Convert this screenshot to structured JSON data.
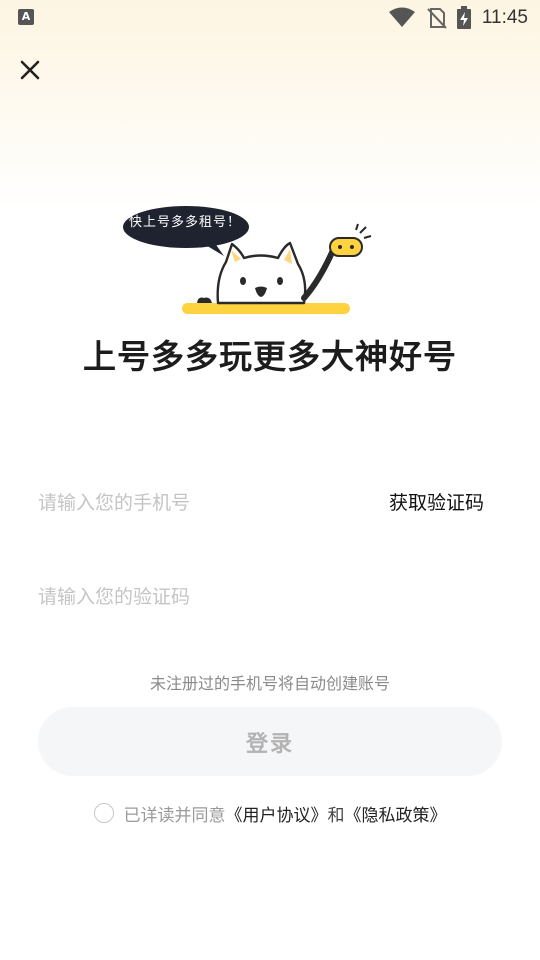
{
  "status_bar": {
    "app_icon_letter": "A",
    "time": "11:45"
  },
  "illustration": {
    "speech_bubble": "快上号多多租号！"
  },
  "slogan": "上号多多玩更多大神好号",
  "form": {
    "phone_placeholder": "请输入您的手机号",
    "get_code_label": "获取验证码",
    "code_placeholder": "请输入您的验证码"
  },
  "hint": "未注册过的手机号将自动创建账号",
  "login_label": "登录",
  "agreement": {
    "prefix": "已详读并同意",
    "user_agreement": "《用户协议》",
    "conjunction": "和",
    "privacy_policy": "《隐私政策》"
  }
}
